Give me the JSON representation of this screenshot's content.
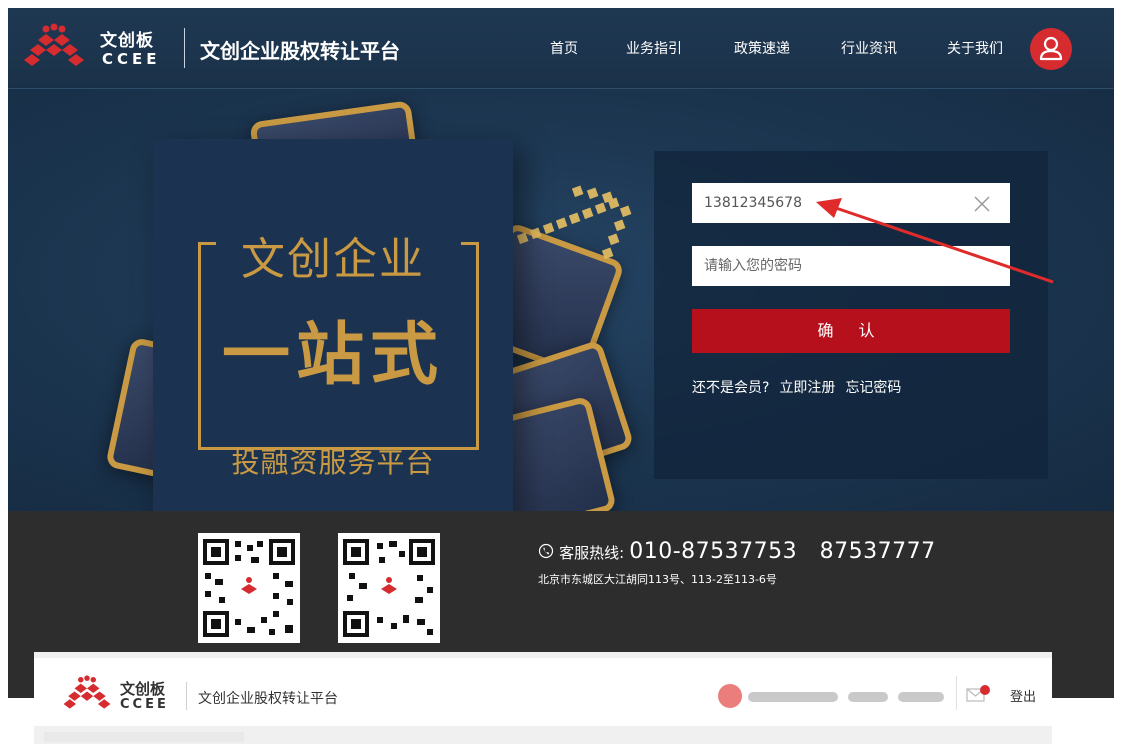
{
  "header": {
    "brand_cn": "文创板",
    "brand_en": "CCEE",
    "platform_name": "文创企业股权转让平台",
    "nav": [
      "首页",
      "业务指引",
      "政策速递",
      "行业资讯",
      "关于我们"
    ]
  },
  "promo": {
    "line1": "文创企业",
    "line2": "一站式",
    "line3": "投融资服务平台"
  },
  "login": {
    "phone_value": "13812345678",
    "password_placeholder": "请输入您的密码",
    "confirm_label": "确  认",
    "not_member": "还不是会员?",
    "register": "立即注册",
    "forgot": "忘记密码"
  },
  "footer": {
    "hotline_label": "客服热线:",
    "hotline_numbers": "010-87537753   87537777",
    "address": "北京市东城区大江胡同113号、113-2至113-6号"
  },
  "overlay": {
    "brand_cn": "文创板",
    "brand_en": "CCEE",
    "platform_name": "文创企业股权转让平台",
    "logout": "登出"
  },
  "icons": {
    "user": "user-icon",
    "phone": "phone-icon",
    "clear": "close-icon",
    "mail": "mail-icon"
  },
  "colors": {
    "brand_red": "#d62c2f",
    "confirm_red": "#b5101b",
    "gold": "#c99a43",
    "header_blue": "#1f3852",
    "annotation_arrow": "#e02b2b"
  }
}
